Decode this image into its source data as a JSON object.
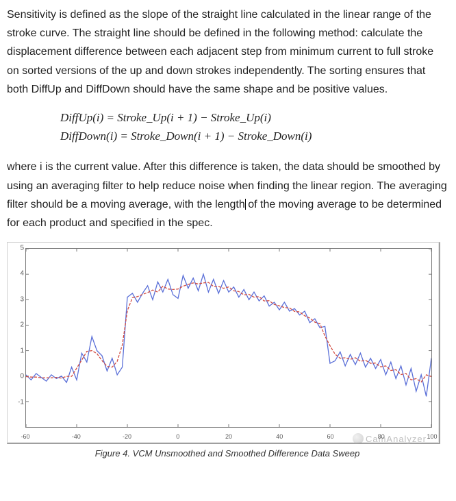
{
  "para1": "Sensitivity is defined as the slope of the straight line calculated in the linear range of the stroke curve. The straight line should be defined in the following method: calculate the displacement difference between each adjacent step from minimum current to full stroke on sorted versions of the up and down strokes independently. The sorting ensures that both DiffUp and DiffDown should have the same shape and be positive values.",
  "eq1": "DiffUp(i) = Stroke_Up(i + 1) − Stroke_Up(i)",
  "eq2": "DiffDown(i) = Stroke_Down(i + 1) − Stroke_Down(i)",
  "para2a": "where i is the current value. After this difference is taken, the data should be smoothed by using an averaging filter to help reduce noise when finding the linear region. The averaging filter should be a moving average, with the length",
  "para2b": " of the moving average to be determined for each product and specified in the spec.",
  "caption": "Figure 4. VCM Unsmoothed and Smoothed Difference Data Sweep",
  "watermark": "CamAnalyzer",
  "chart_data": {
    "type": "line",
    "title": "",
    "xlabel": "",
    "ylabel": "",
    "xlim": [
      -60,
      100
    ],
    "ylim": [
      -2,
      5
    ],
    "x_ticks": [
      -60,
      -40,
      -20,
      0,
      20,
      40,
      60,
      80,
      100
    ],
    "y_ticks": [
      -1,
      0,
      1,
      2,
      3,
      4,
      5
    ],
    "x": [
      -60,
      -58,
      -56,
      -54,
      -52,
      -50,
      -48,
      -46,
      -44,
      -42,
      -40,
      -38,
      -36,
      -34,
      -32,
      -30,
      -28,
      -26,
      -24,
      -22,
      -20,
      -18,
      -16,
      -14,
      -12,
      -10,
      -8,
      -6,
      -4,
      -2,
      0,
      2,
      4,
      6,
      8,
      10,
      12,
      14,
      16,
      18,
      20,
      22,
      24,
      26,
      28,
      30,
      32,
      34,
      36,
      38,
      40,
      42,
      44,
      46,
      48,
      50,
      52,
      54,
      56,
      58,
      60,
      62,
      64,
      66,
      68,
      70,
      72,
      74,
      76,
      78,
      80,
      82,
      84,
      86,
      88,
      90,
      92,
      94,
      96,
      98,
      100
    ],
    "series": [
      {
        "name": "Unsmoothed",
        "color": "#5a6fd8",
        "values": [
          0.05,
          -0.15,
          0.1,
          -0.05,
          -0.2,
          0.05,
          -0.1,
          0.0,
          -0.25,
          0.35,
          -0.15,
          0.9,
          0.55,
          1.55,
          1.0,
          0.8,
          0.2,
          0.7,
          0.05,
          0.35,
          3.1,
          3.25,
          2.9,
          3.25,
          3.55,
          3.0,
          3.7,
          3.3,
          3.8,
          3.2,
          3.05,
          3.95,
          3.45,
          3.85,
          3.35,
          4.0,
          3.3,
          3.8,
          3.25,
          3.75,
          3.3,
          3.5,
          3.1,
          3.4,
          3.0,
          3.3,
          2.95,
          3.15,
          2.75,
          2.9,
          2.6,
          2.9,
          2.55,
          2.65,
          2.4,
          2.55,
          2.1,
          2.25,
          1.9,
          1.95,
          0.5,
          0.6,
          0.95,
          0.4,
          0.85,
          0.45,
          0.9,
          0.35,
          0.7,
          0.3,
          0.65,
          0.05,
          0.55,
          -0.1,
          0.4,
          -0.35,
          0.3,
          -0.6,
          0.05,
          -0.8,
          0.7
        ]
      },
      {
        "name": "Smoothed",
        "color": "#d24a3f",
        "dashed": true,
        "values": [
          -0.02,
          -0.04,
          -0.04,
          -0.07,
          -0.07,
          -0.07,
          -0.05,
          -0.08,
          -0.01,
          -0.01,
          0.31,
          0.63,
          0.97,
          1.0,
          0.88,
          0.61,
          0.38,
          0.35,
          0.58,
          1.22,
          2.57,
          3.08,
          3.12,
          3.21,
          3.28,
          3.38,
          3.3,
          3.53,
          3.42,
          3.4,
          3.42,
          3.53,
          3.6,
          3.66,
          3.62,
          3.66,
          3.68,
          3.52,
          3.52,
          3.45,
          3.5,
          3.35,
          3.32,
          3.19,
          3.21,
          3.1,
          3.12,
          2.95,
          2.96,
          2.81,
          2.76,
          2.69,
          2.68,
          2.54,
          2.52,
          2.37,
          2.28,
          2.12,
          2.06,
          1.57,
          1.19,
          0.86,
          0.7,
          0.72,
          0.66,
          0.72,
          0.58,
          0.62,
          0.5,
          0.51,
          0.36,
          0.4,
          0.22,
          0.25,
          0.06,
          0.1,
          -0.15,
          -0.1,
          -0.23,
          0.05,
          -0.02
        ]
      }
    ]
  }
}
